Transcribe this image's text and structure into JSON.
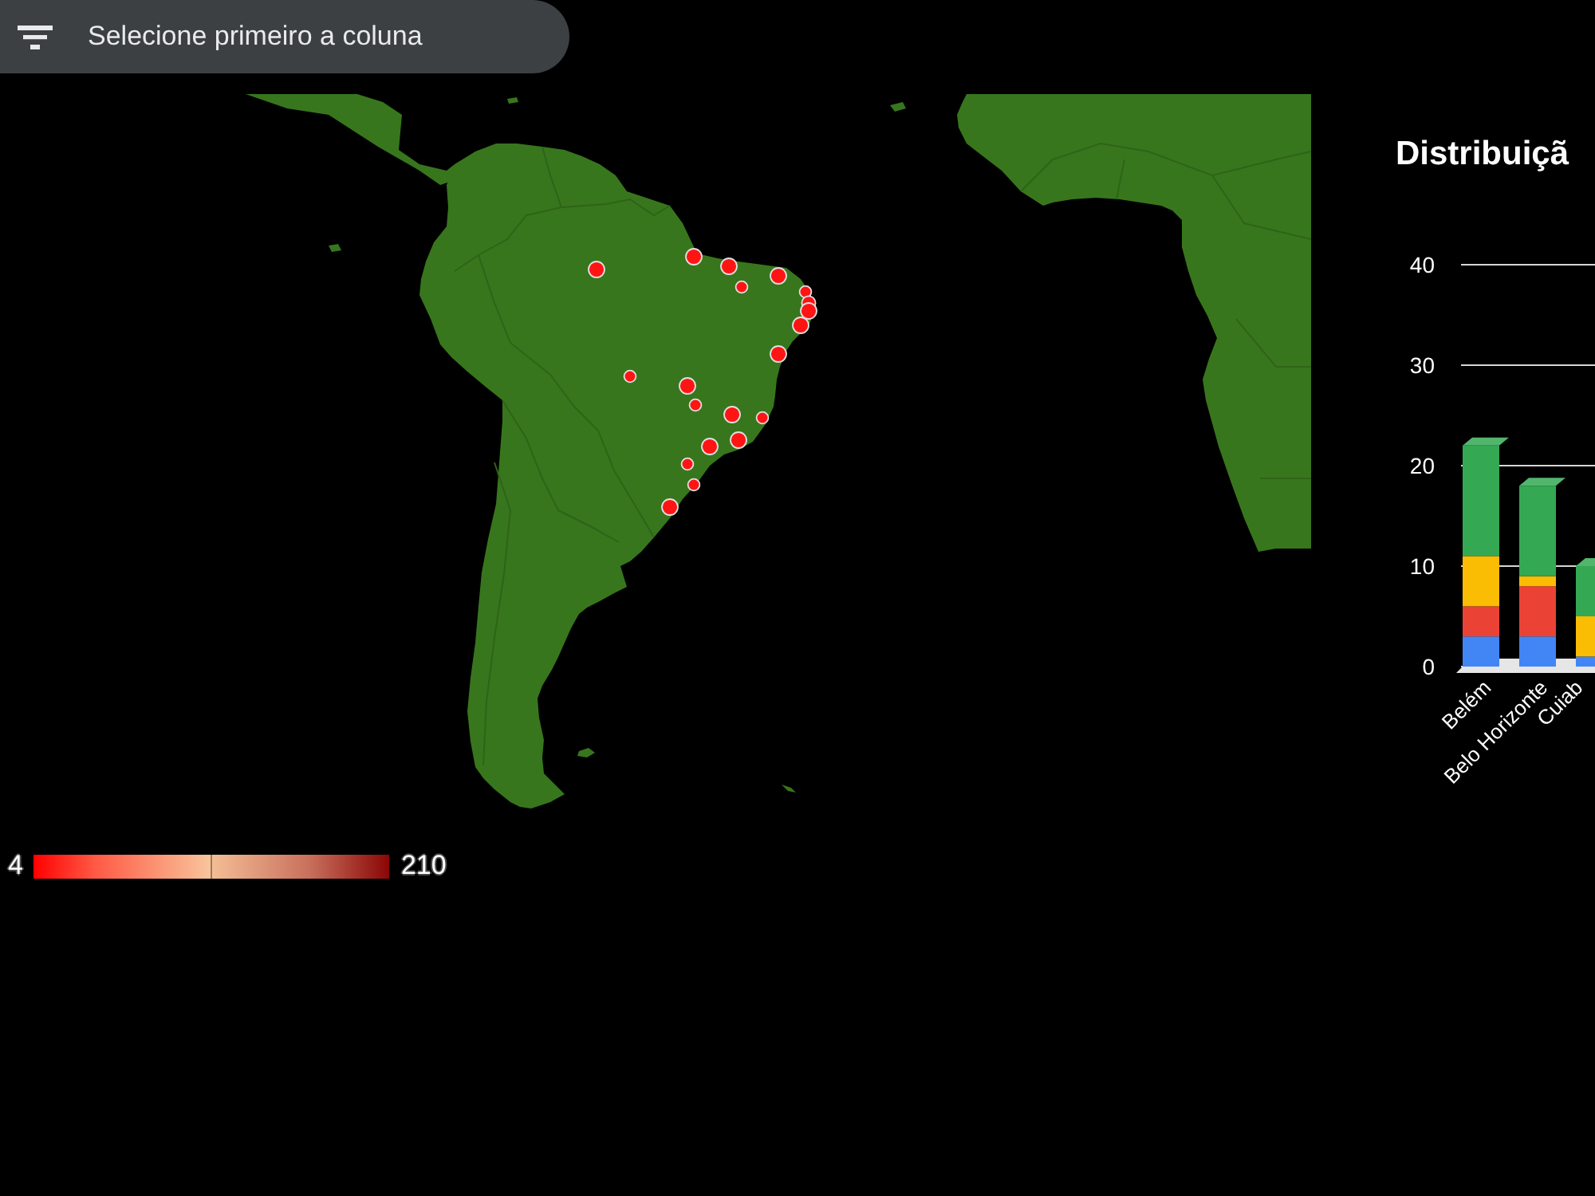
{
  "filter_control": {
    "label": "Selecione primeiro a coluna"
  },
  "map": {
    "legend": {
      "min": "4",
      "max": "210"
    }
  },
  "chart": {
    "chart_data": [
      {
        "type": "bar",
        "title": "Distribuiçã",
        "categories": [
          "Belém",
          "Belo Horizonte",
          "Cuiab"
        ],
        "stacked": true,
        "grid": true,
        "ylim": [
          0,
          40
        ],
        "yticks": [
          0,
          10,
          20,
          30,
          40
        ],
        "series": [
          {
            "color": "#4285f4",
            "values": [
              3,
              3,
              1
            ]
          },
          {
            "color": "#ea4335",
            "values": [
              3,
              5,
              0
            ]
          },
          {
            "color": "#fbbc04",
            "values": [
              5,
              1,
              4
            ]
          },
          {
            "color": "#34a853",
            "values": [
              11,
              9,
              5
            ]
          }
        ]
      }
    ]
  }
}
